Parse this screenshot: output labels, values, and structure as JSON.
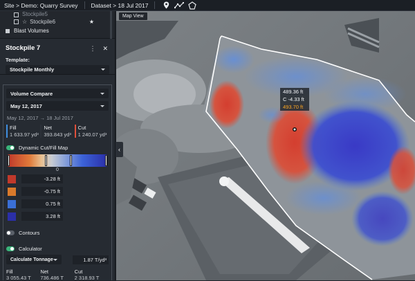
{
  "topbar": {
    "breadcrumb": "Site > Demo: Quarry Survey",
    "dataset": "Dataset > 18 Jul 2017",
    "icons": [
      "map-pin-icon",
      "measure-line-icon",
      "polygon-icon"
    ]
  },
  "layers": {
    "items": [
      {
        "label": "Stockpile5"
      },
      {
        "label": "Stockpile6"
      },
      {
        "label": "Blast Volumes"
      }
    ]
  },
  "panel": {
    "title": "Stockpile 7",
    "template_label": "Template:",
    "template_value": "Stockpile Monthly"
  },
  "compare": {
    "mode": "Volume Compare",
    "date": "May 12, 2017",
    "range": "May 12, 2017 → 18 Jul 2017",
    "stats": {
      "fill_label": "Fill",
      "fill_value": "1 633.97 yd³",
      "net_label": "Net",
      "net_value": "393.843 yd³",
      "cut_label": "Cut",
      "cut_value": "1 240.07 yd³"
    },
    "cutfill_label": "Dynamic Cut/Fill Map",
    "zero_label": "0",
    "legend": [
      {
        "color": "#c0392b",
        "value": "-3.28 ft"
      },
      {
        "color": "#d97a2b",
        "value": "-0.75 ft"
      },
      {
        "color": "#3a6fd6",
        "value": "0.75 ft"
      },
      {
        "color": "#2b2fa8",
        "value": "3.28 ft"
      }
    ],
    "contours_label": "Contours",
    "calculator_label": "Calculator",
    "calc_mode": "Calculate Tonnage",
    "calc_rate": "1.87 T/yd³",
    "tonnage": {
      "fill_label": "Fill",
      "fill_value": "3 055.43 T",
      "net_label": "Net",
      "net_value": "736.486 T",
      "cut_label": "Cut",
      "cut_value": "2 318.93 T"
    }
  },
  "map": {
    "label": "Map View",
    "tooltip": [
      "489.36 ft",
      "C -4.33 ft",
      "493.70 ft"
    ]
  },
  "colors": {
    "accent_green": "#3ab37a",
    "fill_blue": "#3f8fe0",
    "cut_red": "#e0503a"
  }
}
